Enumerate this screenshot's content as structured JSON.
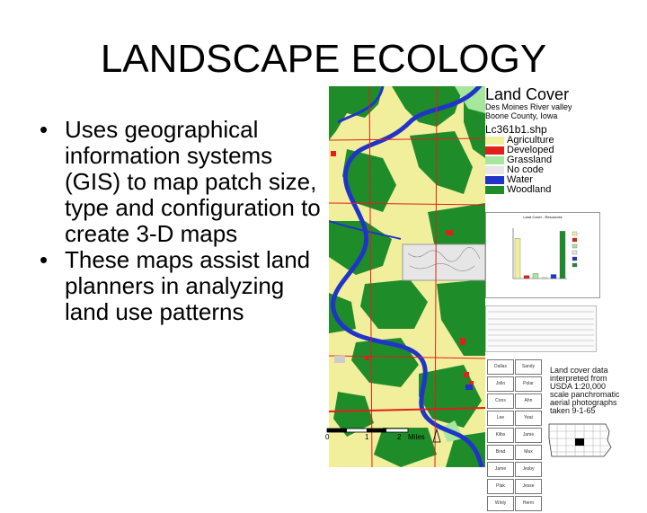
{
  "title": "LANDSCAPE ECOLOGY",
  "bullets": [
    "Uses geographical information systems (GIS) to map patch size, type and configuration to create 3-D maps",
    "These maps assist land planners in analyzing land use patterns"
  ],
  "legend": {
    "title": "Land Cover",
    "subtitle_line1": "Des Moines River valley",
    "subtitle_line2": "Boone County, Iowa",
    "shapefile": "Lc361b1.shp",
    "items": [
      {
        "label": "Agriculture",
        "color": "#f2ef9c"
      },
      {
        "label": "Developed",
        "color": "#e0201a"
      },
      {
        "label": "Grassland",
        "color": "#a7e79d"
      },
      {
        "label": "No code",
        "color": "#e6e6e6"
      },
      {
        "label": "Water",
        "color": "#2035c8"
      },
      {
        "label": "Woodland",
        "color": "#1f8c2a"
      }
    ]
  },
  "scale": {
    "zero": "0",
    "one": "1",
    "two": "2",
    "unit": "Miles"
  },
  "note_lines": [
    "Land cover data",
    "interpreted from",
    "USDA 1:20,000",
    "scale panchromatic",
    "aerial photographs",
    "taken 9-1-65"
  ],
  "counties": [
    "Dallas",
    "Sandy",
    "Jolin",
    "Polar",
    "Cons",
    "Ahn",
    "Lee",
    "Yeat",
    "Kilbs",
    "Jame",
    "Brad",
    "Max",
    "Jame",
    "Jesby",
    "Plak",
    "Jesse",
    "Winly",
    "Herm"
  ],
  "chart_data": {
    "type": "bar",
    "title": "Land Cover - Resources",
    "categories": [
      "Agriculture",
      "Developed",
      "Grassland",
      "No code",
      "Water",
      "Woodland"
    ],
    "values": [
      40,
      3,
      5,
      1,
      4,
      47
    ],
    "colors": [
      "#f2ef9c",
      "#e0201a",
      "#a7e79d",
      "#e6e6e6",
      "#2035c8",
      "#1f8c2a"
    ],
    "ylim": [
      0,
      50
    ]
  }
}
